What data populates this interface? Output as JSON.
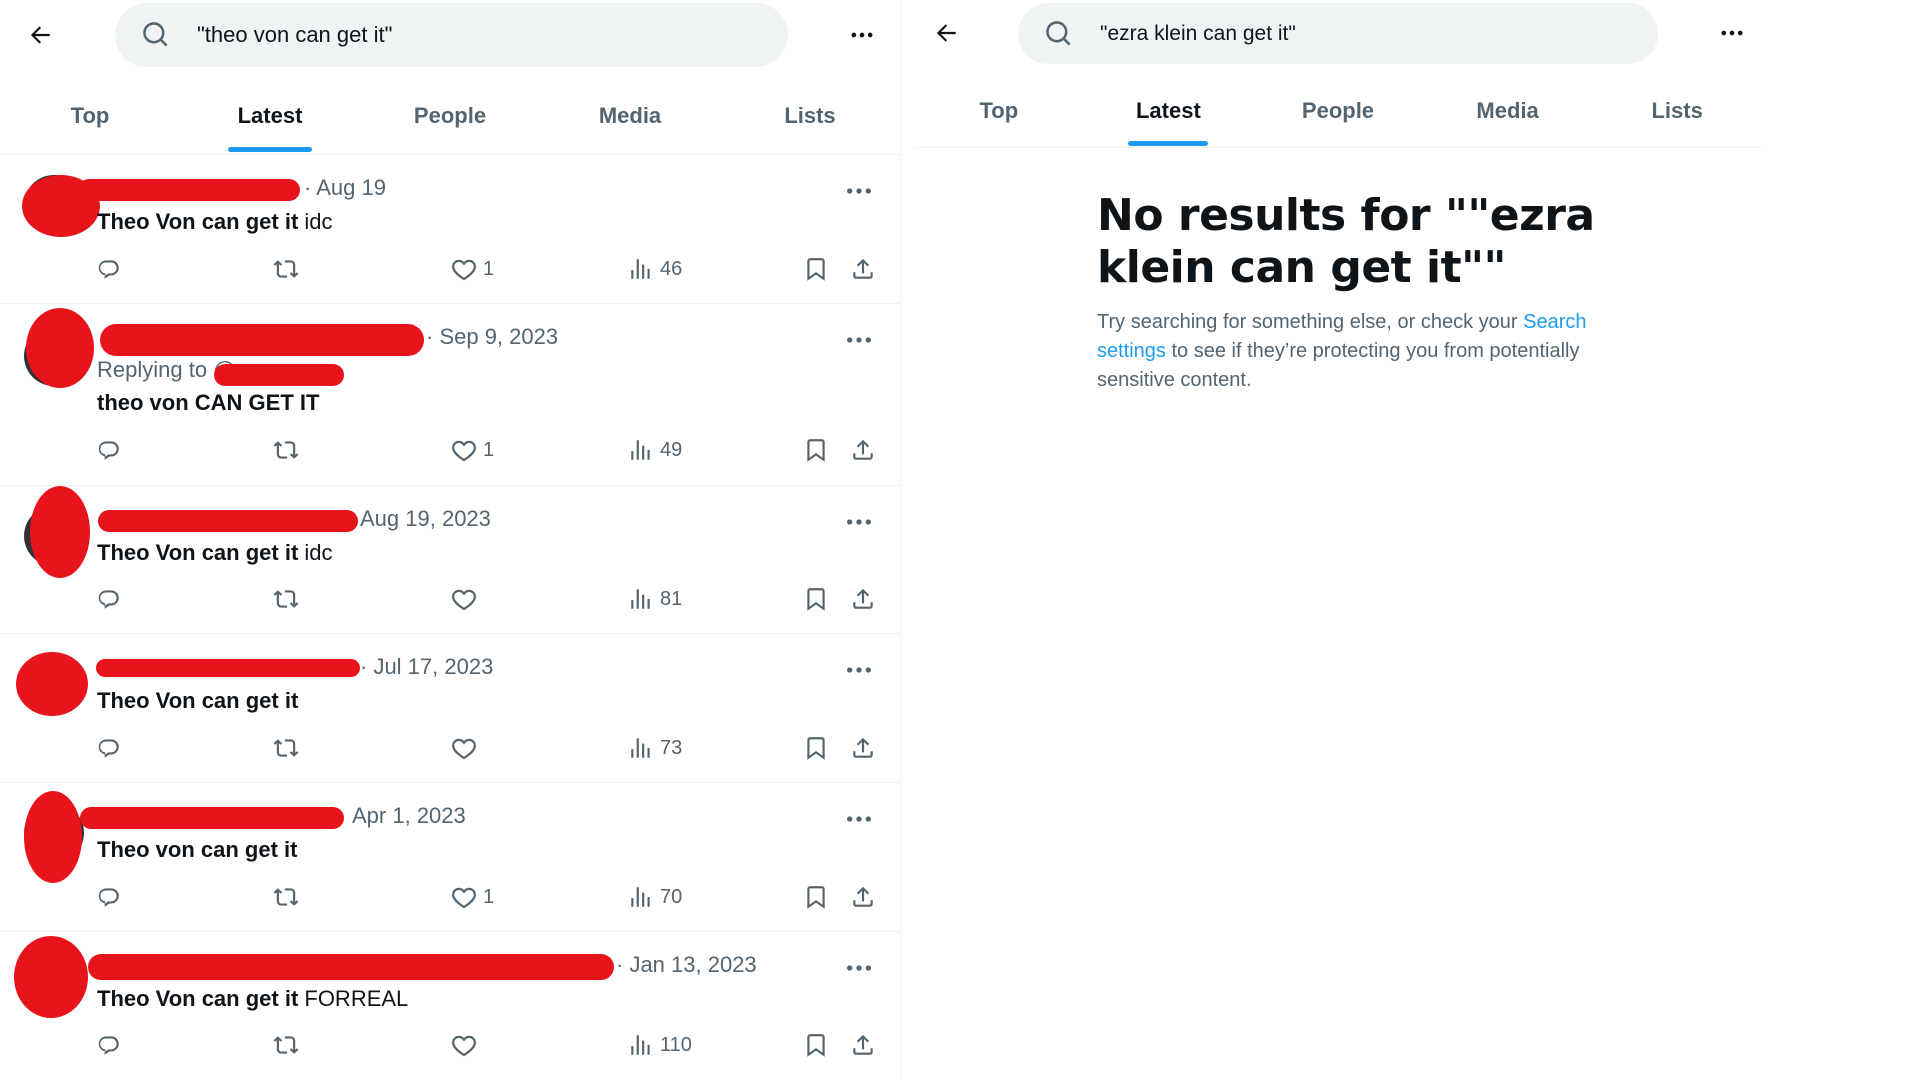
{
  "left": {
    "search_query": "\"theo von can get it\"",
    "tabs": [
      {
        "label": "Top"
      },
      {
        "label": "Latest"
      },
      {
        "label": "People"
      },
      {
        "label": "Media"
      },
      {
        "label": "Lists"
      }
    ],
    "active_tab": "Latest",
    "tweets": [
      {
        "date": "· Aug 19",
        "replying_to": "",
        "text_bold": "Theo Von can get it",
        "text_rest": " idc",
        "likes": "1",
        "views": "46"
      },
      {
        "date": "· Sep 9, 2023",
        "replying_to": "Replying to @",
        "text_bold": "theo von CAN GET IT",
        "text_rest": "",
        "likes": "1",
        "views": "49"
      },
      {
        "date": "Aug 19, 2023",
        "replying_to": "",
        "text_bold": "Theo Von can get it",
        "text_rest": " idc",
        "likes": "",
        "views": "81"
      },
      {
        "date": "· Jul 17, 2023",
        "replying_to": "",
        "text_bold": "Theo Von can get it",
        "text_rest": "",
        "likes": "",
        "views": "73"
      },
      {
        "date": "Apr 1, 2023",
        "replying_to": "",
        "text_bold": "Theo von can get it",
        "text_rest": "",
        "likes": "1",
        "views": "70"
      },
      {
        "date": "· Jan 13, 2023",
        "replying_to": "",
        "text_bold": "Theo Von can get it",
        "text_rest": " FORREAL",
        "likes": "",
        "views": "110"
      }
    ]
  },
  "right": {
    "search_query": "\"ezra klein can get it\"",
    "tabs": [
      {
        "label": "Top"
      },
      {
        "label": "Latest"
      },
      {
        "label": "People"
      },
      {
        "label": "Media"
      },
      {
        "label": "Lists"
      }
    ],
    "active_tab": "Latest",
    "no_results_title": "No results for \"\"ezra klein can get it\"\"",
    "no_results_text_before": "Try searching for something else, or check your ",
    "no_results_link": "Search settings",
    "no_results_text_after": " to see if they’re protecting you from potentially sensitive content."
  },
  "colors": {
    "accent": "#1d9bf0",
    "redaction": "#e8141c",
    "muted_text": "#536471"
  },
  "icons": [
    "back-arrow-icon",
    "search-icon",
    "more-icon",
    "reply-icon",
    "retweet-icon",
    "like-icon",
    "views-icon",
    "bookmark-icon",
    "share-icon"
  ]
}
